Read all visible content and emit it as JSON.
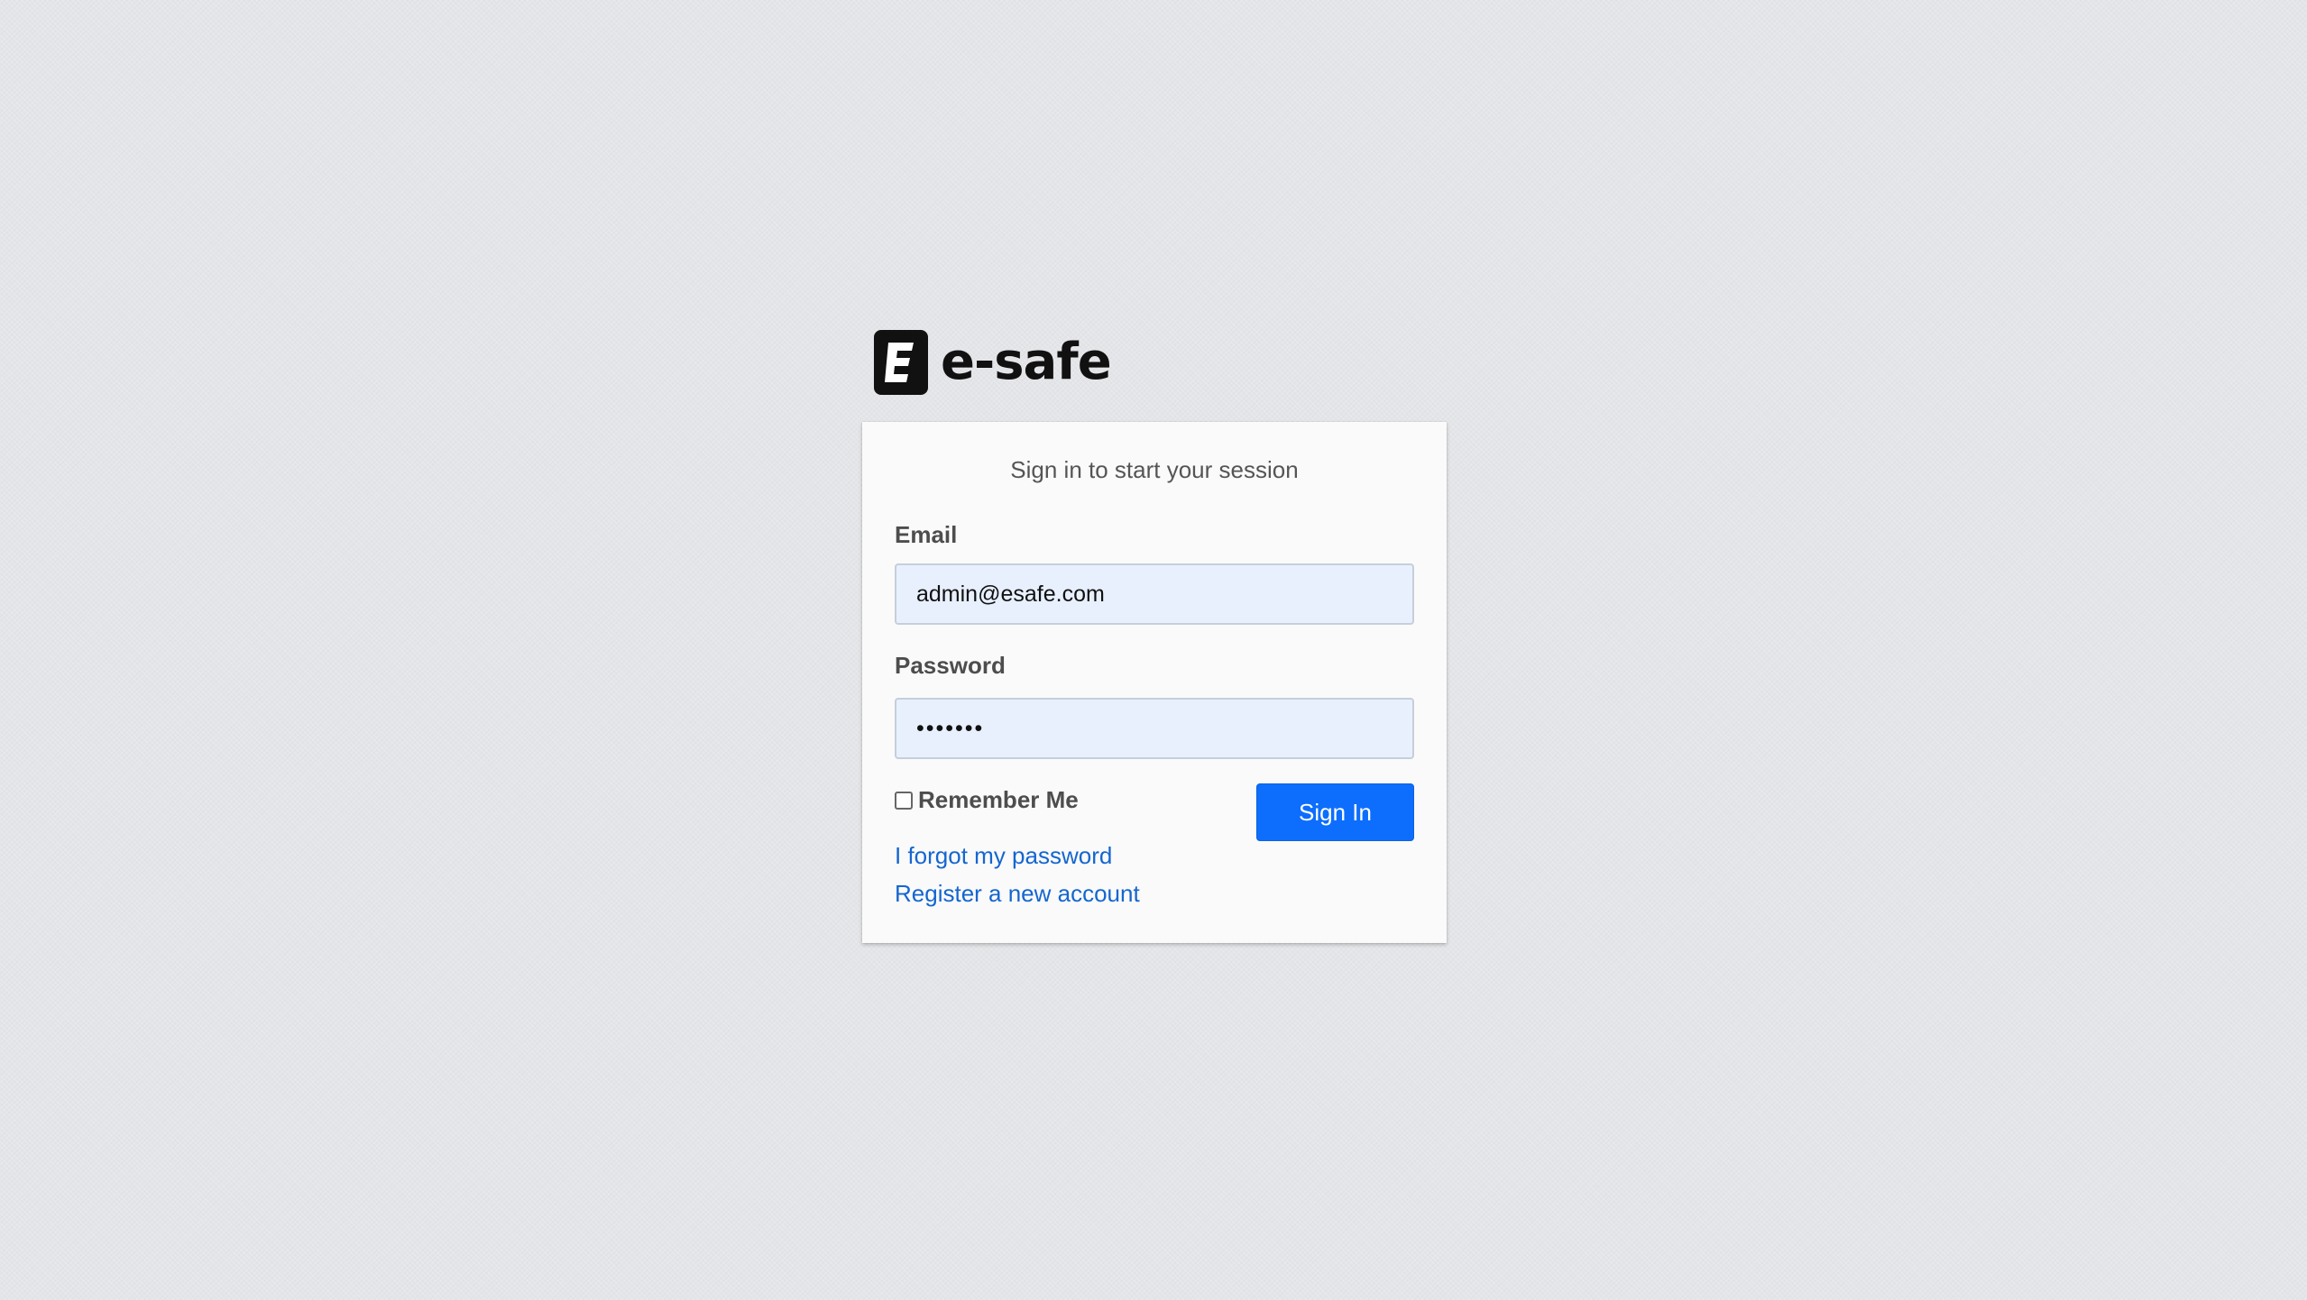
{
  "brand": {
    "name": "e-safe",
    "logo_icon": "e-safe-logo-icon"
  },
  "login": {
    "subtitle": "Sign in to start your session",
    "email_label": "Email",
    "email_value": "admin@esafe.com",
    "password_label": "Password",
    "password_value": "•••••••",
    "remember_label": "Remember Me",
    "remember_checked": false,
    "signin_label": "Sign In",
    "forgot_link": "I forgot my password",
    "register_link": "Register a new account"
  },
  "colors": {
    "primary": "#0d6efd",
    "link": "#1466d0",
    "autofill_bg": "#e8f0fe",
    "page_bg": "#e4e5e8"
  }
}
